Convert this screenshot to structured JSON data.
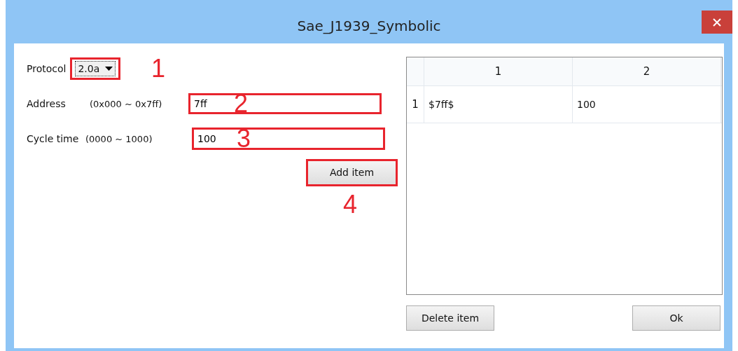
{
  "window": {
    "title": "Sae_J1939_Symbolic"
  },
  "form": {
    "protocol": {
      "label": "Protocol",
      "value": "2.0a",
      "highlighted": true,
      "marker": "1"
    },
    "address": {
      "label": "Address",
      "range": "(0x000 ~ 0x7ff)",
      "value": "7ff",
      "highlighted": true,
      "marker": "2"
    },
    "cycle_time": {
      "label": "Cycle time",
      "range": "(0000 ~ 1000)",
      "value": "100",
      "highlighted": true,
      "marker": "3"
    },
    "add_button": {
      "label": "Add item",
      "highlighted": true,
      "marker": "4"
    }
  },
  "table": {
    "columns": [
      "1",
      "2"
    ],
    "rows": [
      {
        "header": "1",
        "cells": [
          "$7ff$",
          "100"
        ]
      }
    ]
  },
  "buttons": [
    {
      "label": "Delete item"
    },
    {
      "label": "Ok"
    }
  ]
}
